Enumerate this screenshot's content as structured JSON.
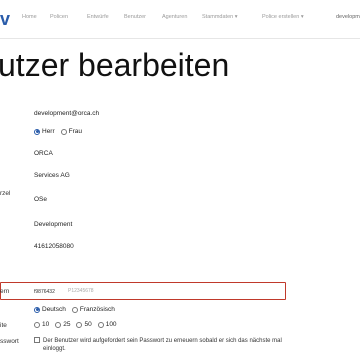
{
  "nav": {
    "brand": "v",
    "items": [
      "Home",
      "Policen",
      "Entwürfe",
      "Benutzer",
      "Agenturen",
      "Stammdaten ▾",
      "Police erstellen ▾"
    ],
    "user": "developme"
  },
  "page": {
    "title": "utzer bearbeiten"
  },
  "form": {
    "email": "development@orca.ch",
    "salutation_options": [
      "Herr",
      "Frau"
    ],
    "salutation_selected": "Herr",
    "first_name": "ORCA",
    "last_name": "Services AG",
    "short_label": "rzel",
    "short_value": "OSe",
    "department": "Development",
    "phone": "41612058080",
    "password_label": "ern",
    "password_value": "f9876432",
    "password_placeholder": "P12345678",
    "language_options": [
      "Deutsch",
      "Französisch"
    ],
    "language_selected": "Deutsch",
    "page_size_label": "ite",
    "page_size_options": [
      "10",
      "25",
      "50",
      "100"
    ],
    "page_size_selected": "",
    "reset_label": "sswort",
    "reset_text": "Der Benutzer wird aufgefordert sein Passwort zu erneuern sobald er sich das nächste mal einloggt."
  },
  "colors": {
    "brand": "#2a5caa",
    "highlight_border": "#c0392b"
  }
}
